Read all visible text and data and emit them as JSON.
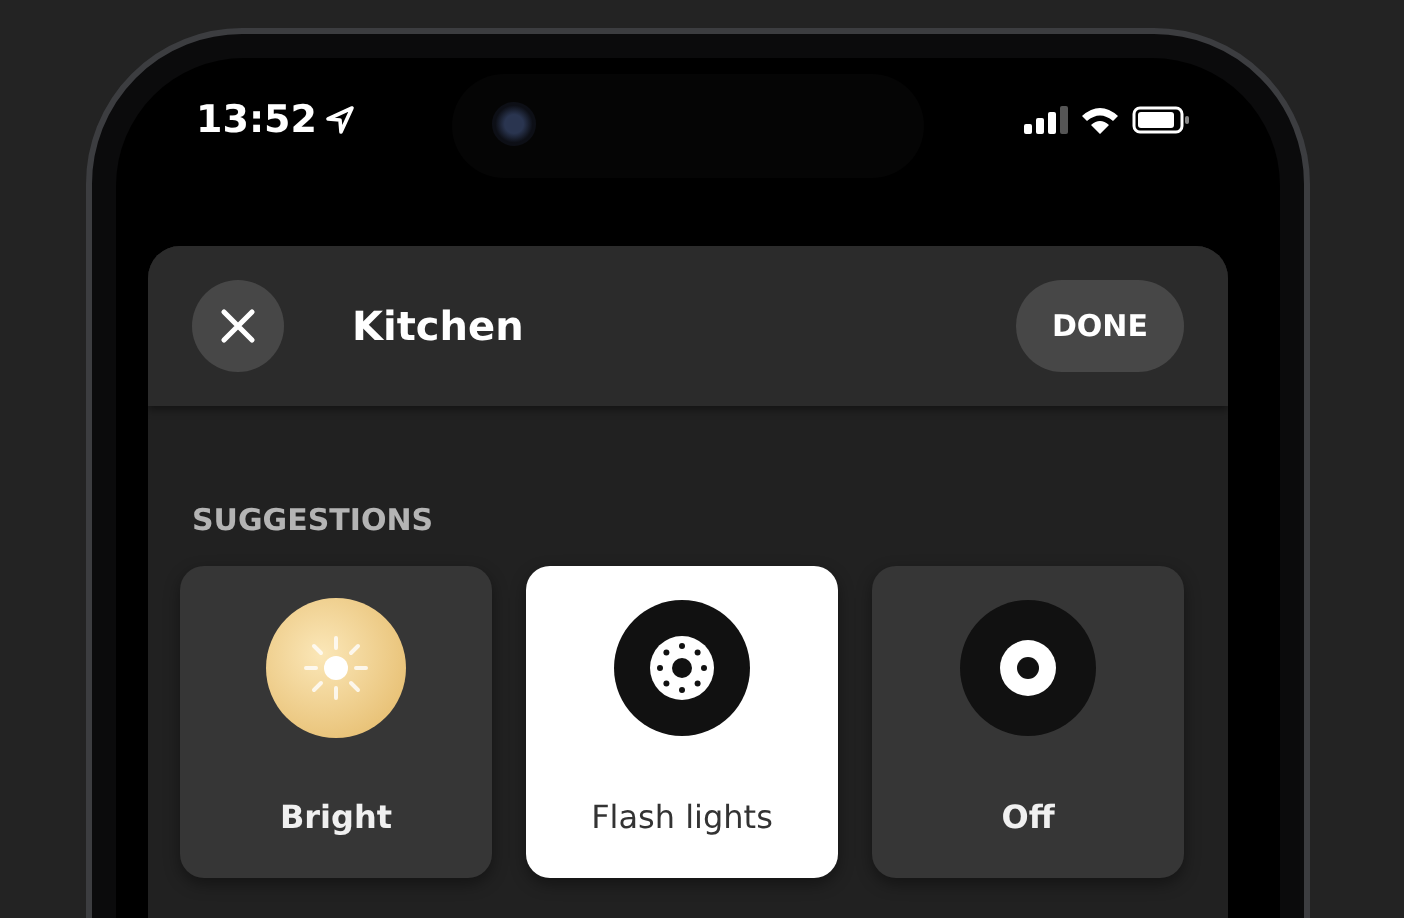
{
  "status_bar": {
    "time": "13:52"
  },
  "header": {
    "title": "Kitchen",
    "done_button": "DONE"
  },
  "section_title": "SUGGESTIONS",
  "suggestions": [
    {
      "label": "Bright",
      "kind": "sun",
      "selected": false
    },
    {
      "label": "Flash lights",
      "kind": "flash",
      "selected": true
    },
    {
      "label": "Off",
      "kind": "off",
      "selected": false
    }
  ]
}
